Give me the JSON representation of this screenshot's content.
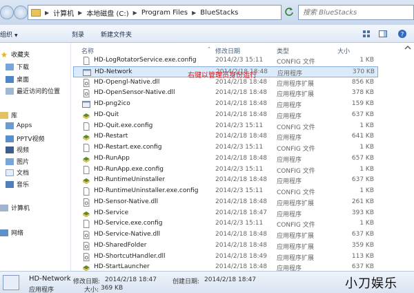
{
  "address": {
    "crumbs": [
      "计算机",
      "本地磁盘 (C:)",
      "Program Files",
      "BlueStacks"
    ],
    "search_placeholder": "搜索 BlueStacks"
  },
  "toolbar": {
    "organize": "组织",
    "burn": "刻录",
    "new_folder": "新建文件夹"
  },
  "sidebar": {
    "favorites": "收藏夹",
    "downloads": "下载",
    "desktop": "桌面",
    "recent": "最近访问的位置",
    "libraries": "库",
    "apps": "Apps",
    "pptv": "PPTV视频",
    "video": "视频",
    "pictures": "图片",
    "docs": "文档",
    "music": "音乐",
    "computer": "计算机",
    "network": "网络"
  },
  "columns": {
    "name": "名称",
    "date": "修改日期",
    "type": "类型",
    "size": "大小"
  },
  "files": [
    {
      "name": "HD-LogRotatorService.exe.config",
      "date": "2014/2/3 15:11",
      "type": "CONFIG 文件",
      "size": "1 KB",
      "icon": "config"
    },
    {
      "name": "HD-Network",
      "date": "2014/2/18 18:48",
      "type": "应用程序",
      "size": "370 KB",
      "icon": "exe"
    },
    {
      "name": "HD-Opengl-Native.dll",
      "date": "2014/2/18 18:48",
      "type": "应用程序扩展",
      "size": "856 KB",
      "icon": "dll"
    },
    {
      "name": "HD-OpenSensor-Native.dll",
      "date": "2014/2/18 18:48",
      "type": "应用程序扩展",
      "size": "378 KB",
      "icon": "dll"
    },
    {
      "name": "HD-png2ico",
      "date": "2014/2/18 18:48",
      "type": "应用程序",
      "size": "159 KB",
      "icon": "exe"
    },
    {
      "name": "HD-Quit",
      "date": "2014/2/18 18:48",
      "type": "应用程序",
      "size": "637 KB",
      "icon": "bluestacks"
    },
    {
      "name": "HD-Quit.exe.config",
      "date": "2014/2/3 15:11",
      "type": "CONFIG 文件",
      "size": "1 KB",
      "icon": "config"
    },
    {
      "name": "HD-Restart",
      "date": "2014/2/18 18:48",
      "type": "应用程序",
      "size": "641 KB",
      "icon": "bluestacks"
    },
    {
      "name": "HD-Restart.exe.config",
      "date": "2014/2/3 15:11",
      "type": "CONFIG 文件",
      "size": "1 KB",
      "icon": "config"
    },
    {
      "name": "HD-RunApp",
      "date": "2014/2/18 18:48",
      "type": "应用程序",
      "size": "657 KB",
      "icon": "bluestacks"
    },
    {
      "name": "HD-RunApp.exe.config",
      "date": "2014/2/3 15:11",
      "type": "CONFIG 文件",
      "size": "1 KB",
      "icon": "config"
    },
    {
      "name": "HD-RuntimeUninstaller",
      "date": "2014/2/18 18:48",
      "type": "应用程序",
      "size": "637 KB",
      "icon": "bluestacks"
    },
    {
      "name": "HD-RuntimeUninstaller.exe.config",
      "date": "2014/2/3 15:11",
      "type": "CONFIG 文件",
      "size": "1 KB",
      "icon": "config"
    },
    {
      "name": "HD-Sensor-Native.dll",
      "date": "2014/2/18 18:48",
      "type": "应用程序扩展",
      "size": "261 KB",
      "icon": "dll"
    },
    {
      "name": "HD-Service",
      "date": "2014/2/18 18:47",
      "type": "应用程序",
      "size": "393 KB",
      "icon": "bluestacks"
    },
    {
      "name": "HD-Service.exe.config",
      "date": "2014/2/3 15:11",
      "type": "CONFIG 文件",
      "size": "1 KB",
      "icon": "config"
    },
    {
      "name": "HD-Service-Native.dll",
      "date": "2014/2/18 18:48",
      "type": "应用程序扩展",
      "size": "637 KB",
      "icon": "dll"
    },
    {
      "name": "HD-SharedFolder",
      "date": "2014/2/18 18:48",
      "type": "应用程序扩展",
      "size": "359 KB",
      "icon": "dll"
    },
    {
      "name": "HD-ShortcutHandler.dll",
      "date": "2014/2/18 18:49",
      "type": "应用程序扩展",
      "size": "113 KB",
      "icon": "dll"
    },
    {
      "name": "HD-StartLauncher",
      "date": "2014/2/18 18:48",
      "type": "应用程序",
      "size": "637 KB",
      "icon": "bluestacks"
    }
  ],
  "annotation": "右键以管理员身份运行",
  "status": {
    "name": "HD-Network",
    "modified_label": "修改日期:",
    "modified": "2014/2/18 18:47",
    "created_label": "创建日期:",
    "created": "2014/2/18 18:47",
    "type": "应用程序",
    "size_label": "大小:",
    "size": "369 KB"
  },
  "watermark": "小刀娱乐",
  "colors": {
    "selection": "#dcebfc",
    "annotation": "#d21919",
    "bluestacks_icon": "#6a8a1e"
  }
}
